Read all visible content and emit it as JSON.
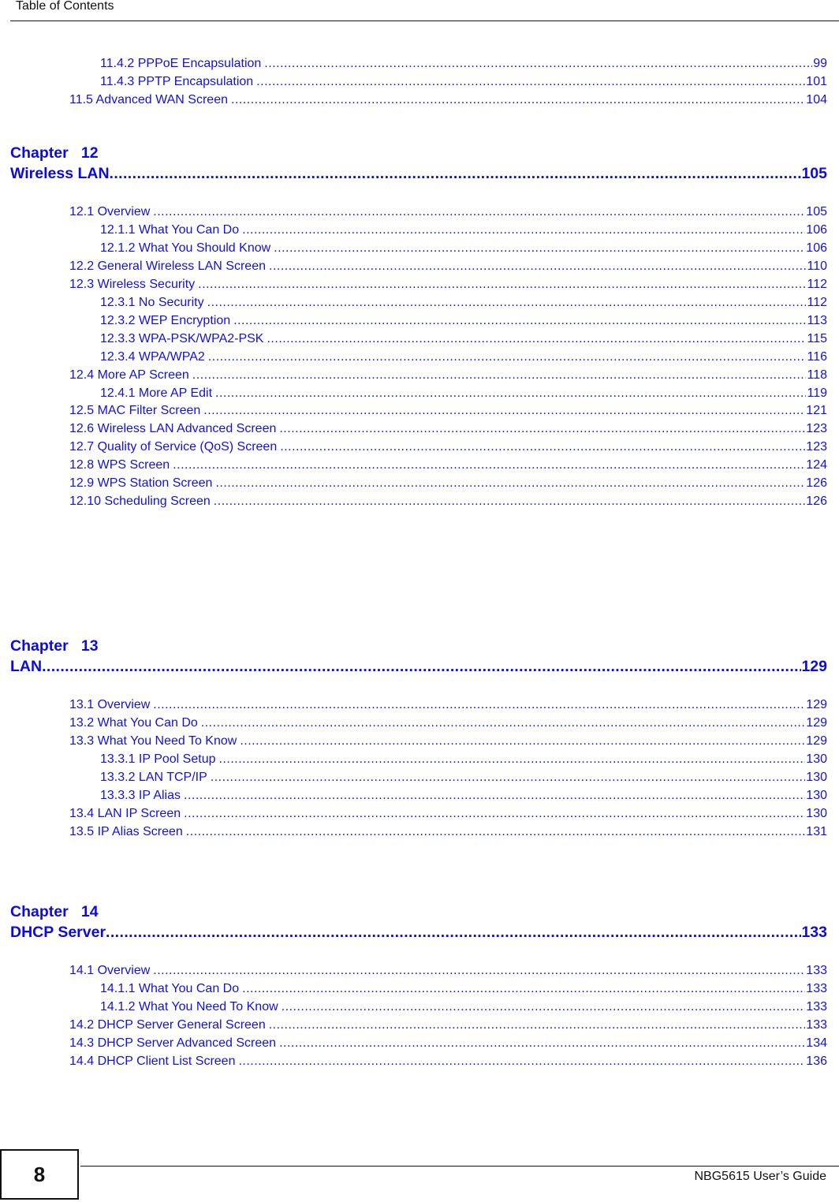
{
  "header": {
    "title": "Table of Contents"
  },
  "pre_entries": [
    {
      "label": "11.4.2 PPPoE Encapsulation",
      "page": "99",
      "level": 2
    },
    {
      "label": "11.4.3 PPTP Encapsulation",
      "page": "101",
      "level": 2
    },
    {
      "label": "11.5 Advanced WAN Screen",
      "page": "104",
      "level": 1
    }
  ],
  "chapters": [
    {
      "chapter_label": "Chapter   12",
      "title": "Wireless LAN",
      "page": "105",
      "entries": [
        {
          "label": "12.1 Overview",
          "page": "105",
          "level": 1
        },
        {
          "label": "12.1.1 What You Can Do",
          "page": "106",
          "level": 2
        },
        {
          "label": "12.1.2 What You Should Know",
          "page": "106",
          "level": 2
        },
        {
          "label": "12.2 General Wireless LAN Screen",
          "page": "110",
          "level": 1
        },
        {
          "label": "12.3 Wireless Security",
          "page": "112",
          "level": 1
        },
        {
          "label": "12.3.1 No Security",
          "page": "112",
          "level": 2
        },
        {
          "label": "12.3.2 WEP Encryption",
          "page": "113",
          "level": 2
        },
        {
          "label": "12.3.3 WPA-PSK/WPA2-PSK",
          "page": "115",
          "level": 2
        },
        {
          "label": "12.3.4 WPA/WPA2",
          "page": "116",
          "level": 2
        },
        {
          "label": "12.4 More AP Screen",
          "page": "118",
          "level": 1
        },
        {
          "label": "12.4.1 More AP Edit",
          "page": "119",
          "level": 2
        },
        {
          "label": "12.5 MAC Filter Screen",
          "page": "121",
          "level": 1
        },
        {
          "label": "12.6 Wireless LAN Advanced Screen",
          "page": "123",
          "level": 1
        },
        {
          "label": "12.7 Quality of Service (QoS) Screen",
          "page": "123",
          "level": 1
        },
        {
          "label": "12.8 WPS Screen",
          "page": "124",
          "level": 1
        },
        {
          "label": "12.9 WPS Station Screen",
          "page": "126",
          "level": 1
        },
        {
          "label": "12.10 Scheduling Screen",
          "page": "126",
          "level": 1
        }
      ]
    },
    {
      "chapter_label": "Chapter   13",
      "title": "LAN",
      "page": "129",
      "entries": [
        {
          "label": "13.1 Overview",
          "page": "129",
          "level": 1
        },
        {
          "label": "13.2 What You Can Do",
          "page": "129",
          "level": 1
        },
        {
          "label": "13.3 What You Need To Know",
          "page": "129",
          "level": 1
        },
        {
          "label": "13.3.1 IP Pool Setup",
          "page": "130",
          "level": 2
        },
        {
          "label": "13.3.2 LAN TCP/IP",
          "page": "130",
          "level": 2
        },
        {
          "label": "13.3.3 IP Alias",
          "page": "130",
          "level": 2
        },
        {
          "label": "13.4 LAN IP Screen",
          "page": "130",
          "level": 1
        },
        {
          "label": "13.5 IP Alias Screen",
          "page": "131",
          "level": 1
        }
      ]
    },
    {
      "chapter_label": "Chapter   14",
      "title": "DHCP Server",
      "page": "133",
      "entries": [
        {
          "label": "14.1 Overview",
          "page": "133",
          "level": 1
        },
        {
          "label": "14.1.1 What You Can Do",
          "page": "133",
          "level": 2
        },
        {
          "label": "14.1.2 What You Need To Know",
          "page": "133",
          "level": 2
        },
        {
          "label": "14.2 DHCP Server General Screen",
          "page": "133",
          "level": 1
        },
        {
          "label": "14.3 DHCP Server Advanced Screen",
          "page": "134",
          "level": 1
        },
        {
          "label": "14.4 DHCP Client List Screen",
          "page": "136",
          "level": 1
        }
      ]
    }
  ],
  "footer": {
    "page_number": "8",
    "guide_title": "NBG5615 User’s Guide"
  }
}
